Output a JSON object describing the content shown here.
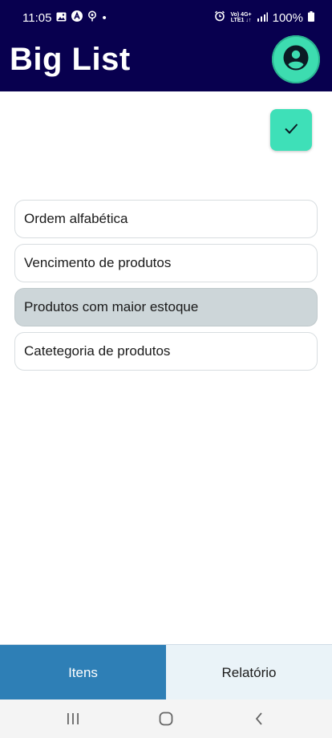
{
  "status": {
    "time": "11:05",
    "dot": "•",
    "net_top": "Vo) 4G+",
    "net_bottom": "LTE1 ↓↑",
    "battery": "100%"
  },
  "header": {
    "title": "Big List",
    "profile_icon": "account-circle-icon",
    "accent": "#08004f"
  },
  "actions": {
    "confirm_icon": "check-icon",
    "confirm_color": "#3ee0b8"
  },
  "sort_options": [
    {
      "label": "Ordem alfabética",
      "selected": false
    },
    {
      "label": "Vencimento de produtos",
      "selected": false
    },
    {
      "label": "Produtos com maior estoque",
      "selected": true
    },
    {
      "label": "Catetegoria de produtos",
      "selected": false
    }
  ],
  "bottom_nav": {
    "tabs": [
      {
        "label": "Itens",
        "active": true
      },
      {
        "label": "Relatório",
        "active": false
      }
    ],
    "active_color": "#2e7fb6"
  },
  "system_nav": [
    "recents-icon",
    "home-icon",
    "back-icon"
  ]
}
